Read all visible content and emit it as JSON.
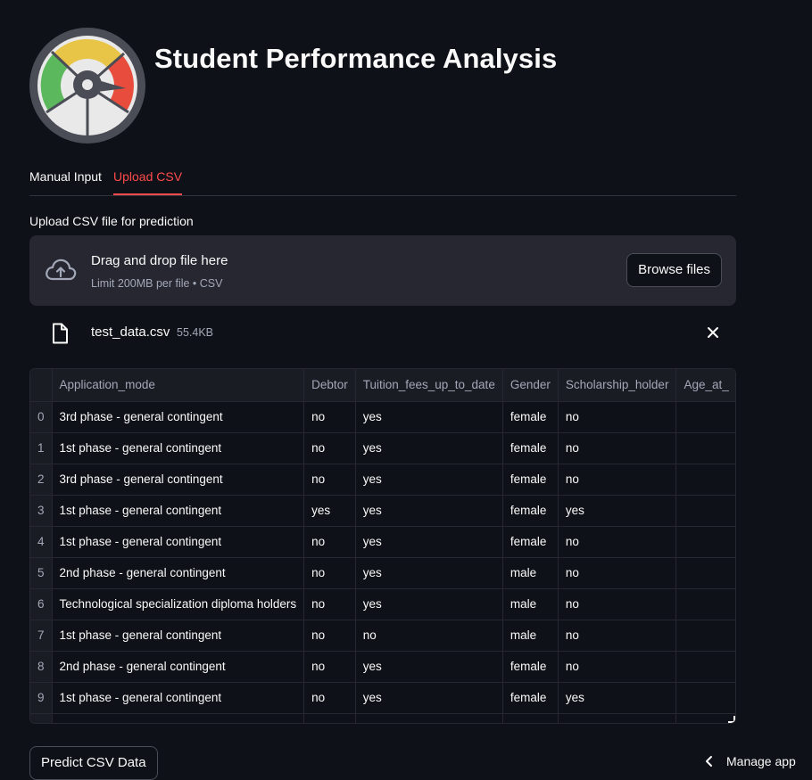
{
  "app": {
    "title": "Student Performance Analysis",
    "logo_icon": "speedometer-gauge-icon",
    "colors": {
      "background": "#0e1117",
      "accent": "#ff4b4b",
      "gauge_green": "#5cb85c",
      "gauge_yellow": "#e8c547",
      "gauge_red": "#e74c3c"
    }
  },
  "tabs": [
    {
      "label": "Manual Input",
      "active": false
    },
    {
      "label": "Upload CSV",
      "active": true
    }
  ],
  "uploader": {
    "label": "Upload CSV file for prediction",
    "drop_text": "Drag and drop file here",
    "limit_text": "Limit 200MB per file • CSV",
    "browse_label": "Browse files",
    "icon": "cloud-upload-icon"
  },
  "file": {
    "name": "test_data.csv",
    "size": "55.4KB",
    "icon": "file-icon",
    "remove_icon": "close-icon"
  },
  "table": {
    "columns": [
      "",
      "Application_mode",
      "Debtor",
      "Tuition_fees_up_to_date",
      "Gender",
      "Scholarship_holder",
      "Age_at_"
    ],
    "rows": [
      [
        "0",
        "3rd phase - general contingent",
        "no",
        "yes",
        "female",
        "no",
        ""
      ],
      [
        "1",
        "1st phase - general contingent",
        "no",
        "yes",
        "female",
        "no",
        ""
      ],
      [
        "2",
        "3rd phase - general contingent",
        "no",
        "yes",
        "female",
        "no",
        ""
      ],
      [
        "3",
        "1st phase - general contingent",
        "yes",
        "yes",
        "female",
        "yes",
        ""
      ],
      [
        "4",
        "1st phase - general contingent",
        "no",
        "yes",
        "female",
        "no",
        ""
      ],
      [
        "5",
        "2nd phase - general contingent",
        "no",
        "yes",
        "male",
        "no",
        ""
      ],
      [
        "6",
        "Technological specialization diploma holders",
        "no",
        "yes",
        "male",
        "no",
        ""
      ],
      [
        "7",
        "1st phase - general contingent",
        "no",
        "no",
        "male",
        "no",
        ""
      ],
      [
        "8",
        "2nd phase - general contingent",
        "no",
        "yes",
        "female",
        "no",
        ""
      ],
      [
        "9",
        "1st phase - general contingent",
        "no",
        "yes",
        "female",
        "yes",
        ""
      ],
      [
        "",
        "",
        "",
        "",
        "",
        "",
        ""
      ]
    ]
  },
  "actions": {
    "predict_label": "Predict CSV Data",
    "manage_app_label": "Manage app",
    "manage_icon": "chevron-left-icon"
  }
}
